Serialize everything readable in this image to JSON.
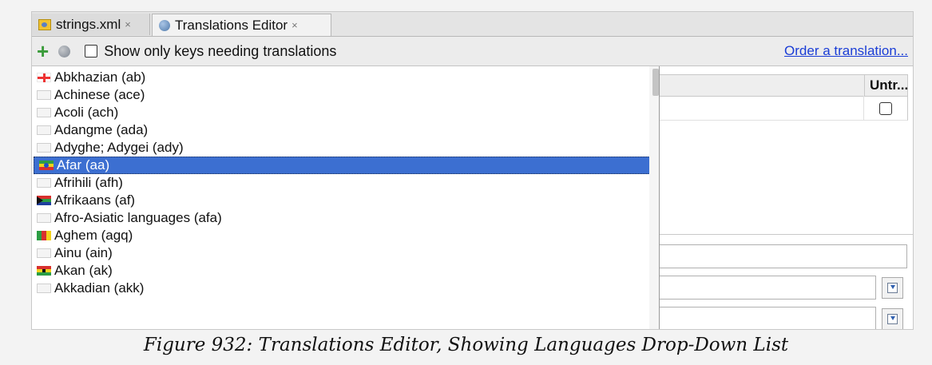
{
  "tabs": [
    {
      "label": "strings.xml",
      "close": "×",
      "icon": "xml-file-icon"
    },
    {
      "label": "Translations Editor",
      "close": "×",
      "icon": "globe-icon"
    }
  ],
  "toolbar": {
    "add_icon": "+",
    "show_only_label": "Show only keys needing translations",
    "show_only_checked": false,
    "order_link": "Order a translation..."
  },
  "table": {
    "header_untranslatable": "Untr...",
    "row_checkbox_checked": false
  },
  "languages": [
    {
      "label": "Abkhazian (ab)",
      "flag": "ab",
      "selected": false
    },
    {
      "label": "Achinese (ace)",
      "flag": "none",
      "selected": false
    },
    {
      "label": "Acoli (ach)",
      "flag": "none",
      "selected": false
    },
    {
      "label": "Adangme (ada)",
      "flag": "none",
      "selected": false
    },
    {
      "label": "Adyghe; Adygei (ady)",
      "flag": "none",
      "selected": false
    },
    {
      "label": "Afar (aa)",
      "flag": "aa",
      "selected": true
    },
    {
      "label": "Afrihili (afh)",
      "flag": "none",
      "selected": false
    },
    {
      "label": "Afrikaans (af)",
      "flag": "af",
      "selected": false
    },
    {
      "label": "Afro-Asiatic languages (afa)",
      "flag": "none",
      "selected": false
    },
    {
      "label": "Aghem (agq)",
      "flag": "agq",
      "selected": false
    },
    {
      "label": "Ainu (ain)",
      "flag": "none",
      "selected": false
    },
    {
      "label": "Akan (ak)",
      "flag": "ak",
      "selected": false
    },
    {
      "label": "Akkadian (akk)",
      "flag": "none",
      "selected": false
    }
  ],
  "caption": "Figure 932: Translations Editor, Showing Languages Drop-Down List",
  "colors": {
    "selection": "#3c6fd1",
    "link": "#1a3dd6",
    "add_icon": "#3a9b3a"
  }
}
